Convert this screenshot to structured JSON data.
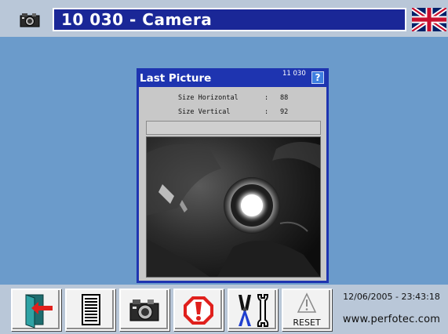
{
  "header": {
    "icon": "camera-icon",
    "title": "10 030 - Camera",
    "language_flag": "uk-flag-icon"
  },
  "dialog": {
    "title": "Last Picture",
    "number": "11 030",
    "help": "?",
    "rows": [
      {
        "label": "Size Horizontal",
        "sep": ":",
        "value": "88"
      },
      {
        "label": "Size Vertical",
        "sep": ":",
        "value": "92"
      }
    ]
  },
  "toolbar": {
    "buttons": [
      {
        "name": "exit-button",
        "icon": "exit-door-icon"
      },
      {
        "name": "document-button",
        "icon": "document-icon"
      },
      {
        "name": "camera-button",
        "icon": "camera-icon"
      },
      {
        "name": "alarm-button",
        "icon": "warning-stop-icon"
      },
      {
        "name": "tools-button",
        "icon": "tools-icon"
      },
      {
        "name": "reset-button",
        "icon": "warning-triangle-icon",
        "label": "RESET"
      }
    ],
    "datetime": "12/06/2005 - 23:43:18",
    "website": "www.perfotec.com"
  },
  "colors": {
    "background": "#6b9bcb",
    "bar": "#b9c7d8",
    "title_box": "#1a2797",
    "dialog": "#1e34b0"
  }
}
